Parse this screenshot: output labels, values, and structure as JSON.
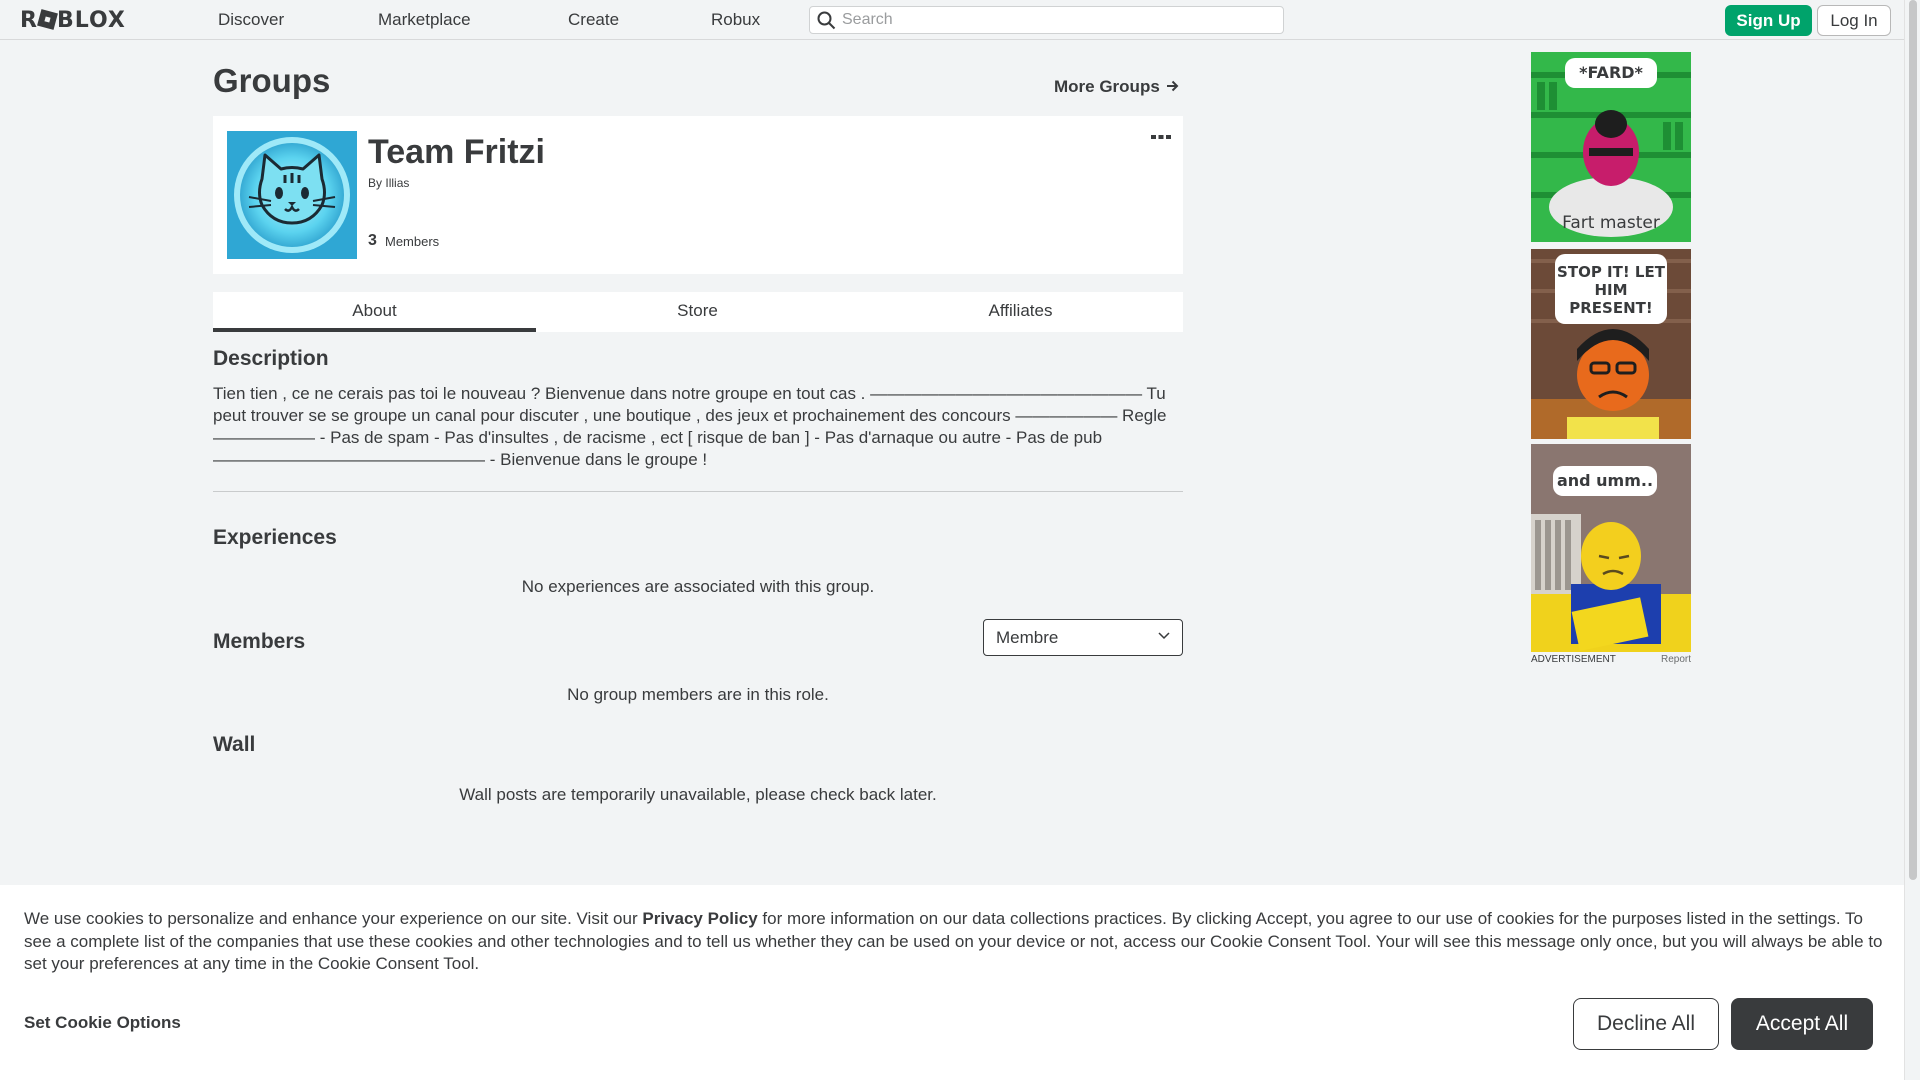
{
  "header": {
    "logo": "ROBLOX",
    "nav": [
      "Discover",
      "Marketplace",
      "Create",
      "Robux"
    ],
    "search_placeholder": "Search",
    "signup_label": "Sign Up",
    "login_label": "Log In"
  },
  "main": {
    "title": "Groups",
    "more_groups_label": "More Groups",
    "group": {
      "name": "Team Fritzi",
      "by_label": "By",
      "owner": "Illias",
      "member_count": "3",
      "members_label": "Members",
      "more_icon": "ellipsis-icon"
    },
    "tabs": [
      {
        "label": "About",
        "active": true
      },
      {
        "label": "Store",
        "active": false
      },
      {
        "label": "Affiliates",
        "active": false
      }
    ],
    "description": {
      "title": "Description",
      "text": "Tien tien , ce ne cerais pas toi le nouveau ? Bienvenue dans notre groupe en tout cas . ———————————————— Tu peut trouver se se groupe un canal pour discuter , une boutique , des jeux et prochainement des concours —————— Regle —————— - Pas de spam - Pas d'insultes , de racisme , ect [ risque de ban ] - Pas d'arnaque ou autre - Pas de pub ———————————————— - Bienvenue dans le groupe !"
    },
    "experiences": {
      "title": "Experiences",
      "empty": "No experiences are associated with this group."
    },
    "members": {
      "title": "Members",
      "role_selected": "Membre",
      "empty": "No group members are in this role."
    },
    "wall": {
      "title": "Wall",
      "empty": "Wall posts are temporarily unavailable, please check back later."
    }
  },
  "ad": {
    "panel1_bubble": "*FARD*",
    "panel1_caption": "Fart master",
    "panel2_bubble": "STOP IT! LET HIM PRESENT!",
    "panel3_bubble": "and umm..",
    "label": "ADVERTISEMENT",
    "report": "Report"
  },
  "cookie": {
    "text_before": "We use cookies to personalize and enhance your experience on our site. Visit our ",
    "privacy_link": "Privacy Policy",
    "text_after": " for more information on our data collections practices. By clicking Accept, you agree to our use of cookies for the purposes listed in the settings. To see a complete list of the companies that use these cookies and other technologies and to tell us whether they can be used on your device or not, access our Cookie Consent Tool. Your will see this message only once, but you will always be able to set your preferences at any time in the Cookie Consent Tool.",
    "options_label": "Set Cookie Options",
    "decline_label": "Decline All",
    "accept_label": "Accept All"
  }
}
